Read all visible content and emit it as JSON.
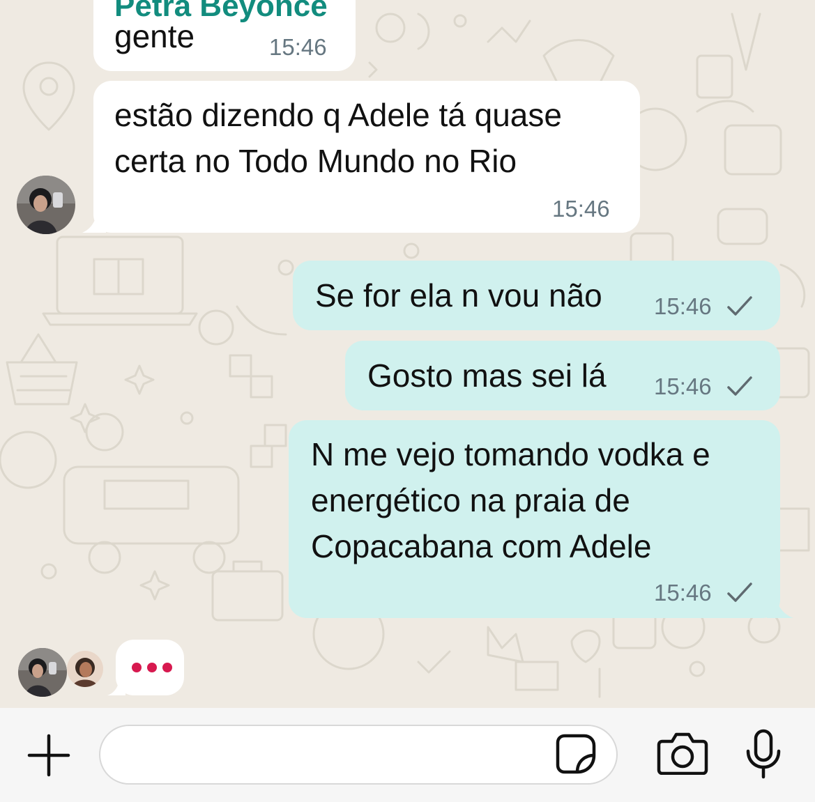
{
  "chat": {
    "partial_sender_name": "Petra Beyoncé",
    "messages": [
      {
        "direction": "incoming",
        "text": "gente",
        "time": "15:46"
      },
      {
        "direction": "incoming",
        "text": "estão dizendo q Adele tá quase\ncerta no Todo Mundo no Rio",
        "time": "15:46"
      },
      {
        "direction": "outgoing",
        "text": "Se for ela n vou não",
        "time": "15:46",
        "status": "sent"
      },
      {
        "direction": "outgoing",
        "text": "Gosto mas sei lá",
        "time": "15:46",
        "status": "sent"
      },
      {
        "direction": "outgoing",
        "text": "N me vejo tomando vodka e\nenergético na praia de\nCopacabana com Adele",
        "time": "15:46",
        "status": "sent"
      }
    ],
    "typing_indicator": {
      "participants": 2
    }
  },
  "input_bar": {
    "plus_icon": "plus-icon",
    "message_value": "",
    "sticker_icon": "sticker-icon",
    "camera_icon": "camera-icon",
    "mic_icon": "microphone-icon"
  },
  "colors": {
    "chat_background": "#efeae2",
    "incoming_bubble": "#ffffff",
    "outgoing_bubble": "#d0f1ee",
    "sender_name": "#128c7e",
    "timestamp": "#667781",
    "typing_dots": "#d7194f",
    "input_bar": "#f6f6f6"
  }
}
